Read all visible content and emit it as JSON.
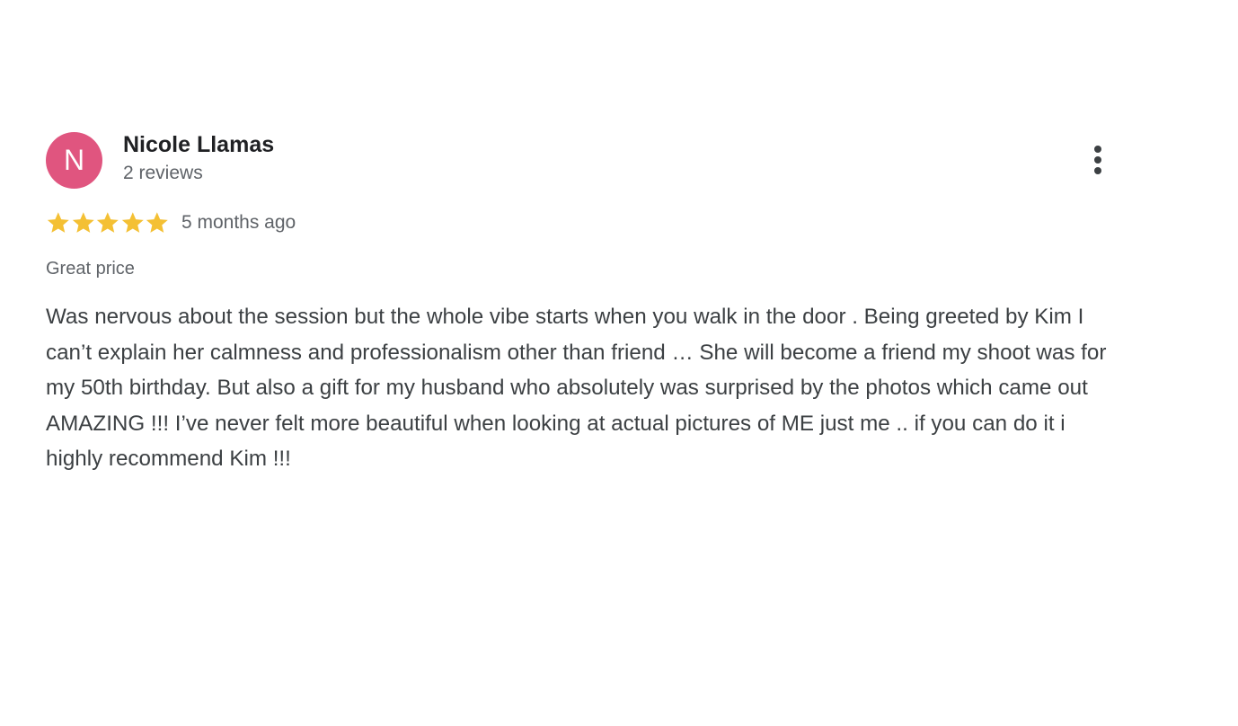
{
  "review": {
    "avatar_letter": "N",
    "avatar_color": "#e0557f",
    "reviewer_name": "Nicole Llamas",
    "review_count": "2 reviews",
    "rating": 5,
    "rating_max": 5,
    "star_color": "#f4c034",
    "date": "5 months ago",
    "title": "Great price",
    "text": "Was nervous about the session but the whole vibe starts when you walk in the door . Being greeted by Kim I can’t explain her calmness and professionalism other than friend … She will become a friend my shoot was for my 50th birthday. But also a gift for my husband who absolutely was surprised by the photos which came out AMAZING !!! I’ve never felt more beautiful when looking at actual pictures of ME just me .. if you can do it i highly recommend Kim !!!"
  },
  "icons": {
    "more": "more-vert-icon",
    "star": "star-icon"
  }
}
